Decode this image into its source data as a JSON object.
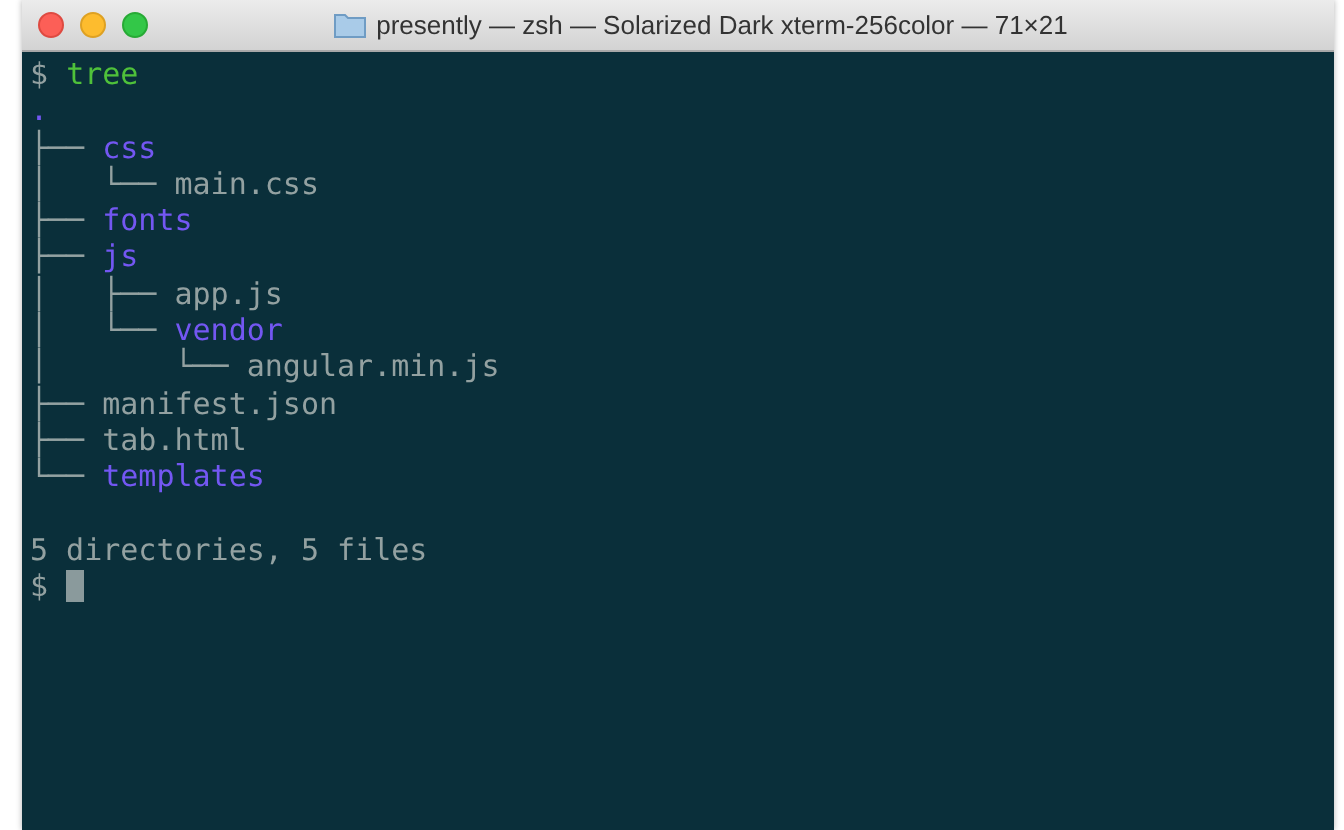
{
  "window": {
    "title": "presently — zsh — Solarized Dark xterm-256color — 71×21"
  },
  "terminal": {
    "command": {
      "prompt": "$",
      "text": "tree"
    },
    "tree": {
      "name": ".",
      "kind": "directory",
      "children": [
        {
          "name": "css",
          "kind": "directory",
          "branch": "├── ",
          "children": [
            {
              "name": "main.css",
              "kind": "file",
              "branch": "│   └── "
            }
          ]
        },
        {
          "name": "fonts",
          "kind": "directory",
          "branch": "├── "
        },
        {
          "name": "js",
          "kind": "directory",
          "branch": "├── ",
          "children": [
            {
              "name": "app.js",
              "kind": "file",
              "branch": "│   ├── "
            },
            {
              "name": "vendor",
              "kind": "directory",
              "branch": "│   └── ",
              "children": [
                {
                  "name": "angular.min.js",
                  "kind": "file",
                  "branch": "│       └── "
                }
              ]
            }
          ]
        },
        {
          "name": "manifest.json",
          "kind": "file",
          "branch": "├── "
        },
        {
          "name": "tab.html",
          "kind": "file",
          "branch": "├── "
        },
        {
          "name": "templates",
          "kind": "directory",
          "branch": "└── "
        }
      ]
    },
    "summary": "5 directories, 5 files",
    "prompt": {
      "prompt": "$"
    }
  }
}
